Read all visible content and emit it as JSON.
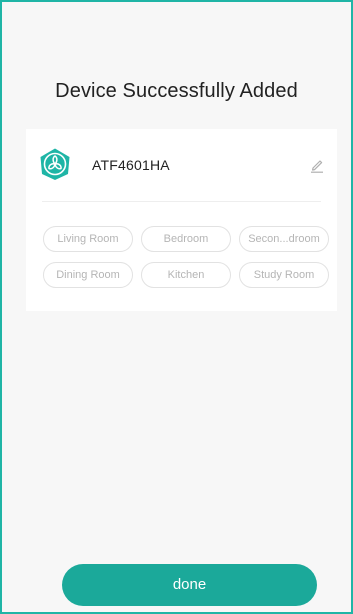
{
  "page": {
    "title": "Device Successfully Added"
  },
  "device": {
    "name": "ATF4601HA",
    "icon": "fan-icon"
  },
  "rooms": [
    "Living Room",
    "Bedroom",
    "Secon...droom",
    "Dining Room",
    "Kitchen",
    "Study Room"
  ],
  "actions": {
    "done_label": "done"
  },
  "colors": {
    "accent": "#1ba99a",
    "frame_border": "#1fb5a6",
    "chip_text": "#b5b5b5",
    "chip_border": "#e2e2e2"
  }
}
